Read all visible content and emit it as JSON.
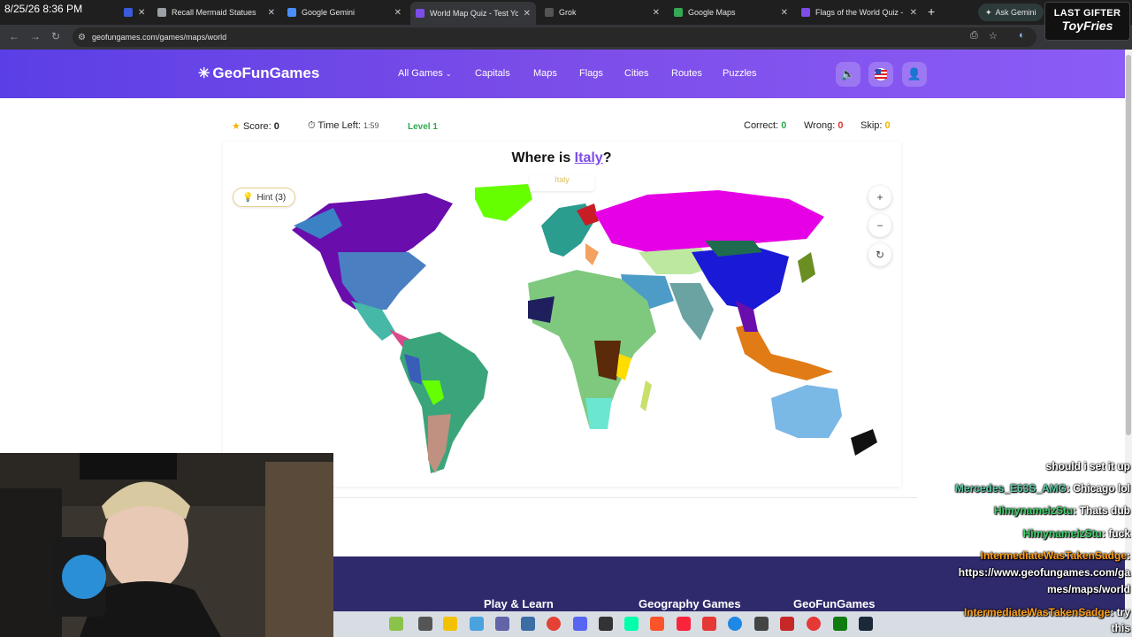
{
  "overlay": {
    "timestamp": "8/25/26 8:36 PM"
  },
  "browser": {
    "tabs": [
      {
        "label": "Recall Mermaid Statues",
        "color": "#9aa0a6"
      },
      {
        "label": "Google Gemini",
        "color": "#4b8df8"
      },
      {
        "label": "World Map Quiz - Test Your",
        "color": "#7c4de8"
      },
      {
        "label": "Grok",
        "color": "#e3e3e3"
      },
      {
        "label": "Google Maps",
        "color": "#34a853"
      },
      {
        "label": "Flags of the World Quiz - W",
        "color": "#7c4de8"
      }
    ],
    "ask_gemini": "Ask Gemini",
    "url": "geofungames.com/games/maps/world",
    "gifter_label": "LAST GIFTER",
    "gifter_name": "ToyFries"
  },
  "site": {
    "logo": "GeoFunGames",
    "nav": [
      "All Games",
      "Capitals",
      "Maps",
      "Flags",
      "Cities",
      "Routes",
      "Puzzles"
    ]
  },
  "game": {
    "score_label": "Score:",
    "score": "0",
    "time_label": "Time Left:",
    "time": "1:59",
    "level": "Level 1",
    "correct_label": "Correct:",
    "correct": "0",
    "wrong_label": "Wrong:",
    "wrong": "0",
    "skip_label": "Skip:",
    "skip": "0",
    "question_prefix": "Where is",
    "country": "Italy",
    "question_suffix": "?",
    "hint": "Hint (3)",
    "tooltip": "Italy"
  },
  "footer": {
    "headings": [
      "Play & Learn",
      "Geography Games",
      "GeoFunGames"
    ]
  },
  "chat": [
    {
      "user": "",
      "msg": "should i set it up",
      "color": "#ffffff"
    },
    {
      "user": "Mercedes_E63S_AMG",
      "msg": ": Chicago lol",
      "color": "#5cc8a8"
    },
    {
      "user": "HimynameizStu",
      "msg": ": Thats dub",
      "color": "#3fd16b"
    },
    {
      "user": "HimynameizStu",
      "msg": ": fuck",
      "color": "#3fd16b"
    },
    {
      "user": "IntermediateWasTakenSadge",
      "msg": ":",
      "color": "#ff9f1a"
    },
    {
      "user": "",
      "msg": "https://www.geofungames.com/ga",
      "color": "#ffffff"
    },
    {
      "user": "",
      "msg": "mes/maps/world",
      "color": "#ffffff"
    },
    {
      "user": "IntermediateWasTakenSadge",
      "msg": ": try",
      "color": "#ff9f1a"
    },
    {
      "user": "",
      "msg": "this",
      "color": "#ffffff"
    }
  ]
}
